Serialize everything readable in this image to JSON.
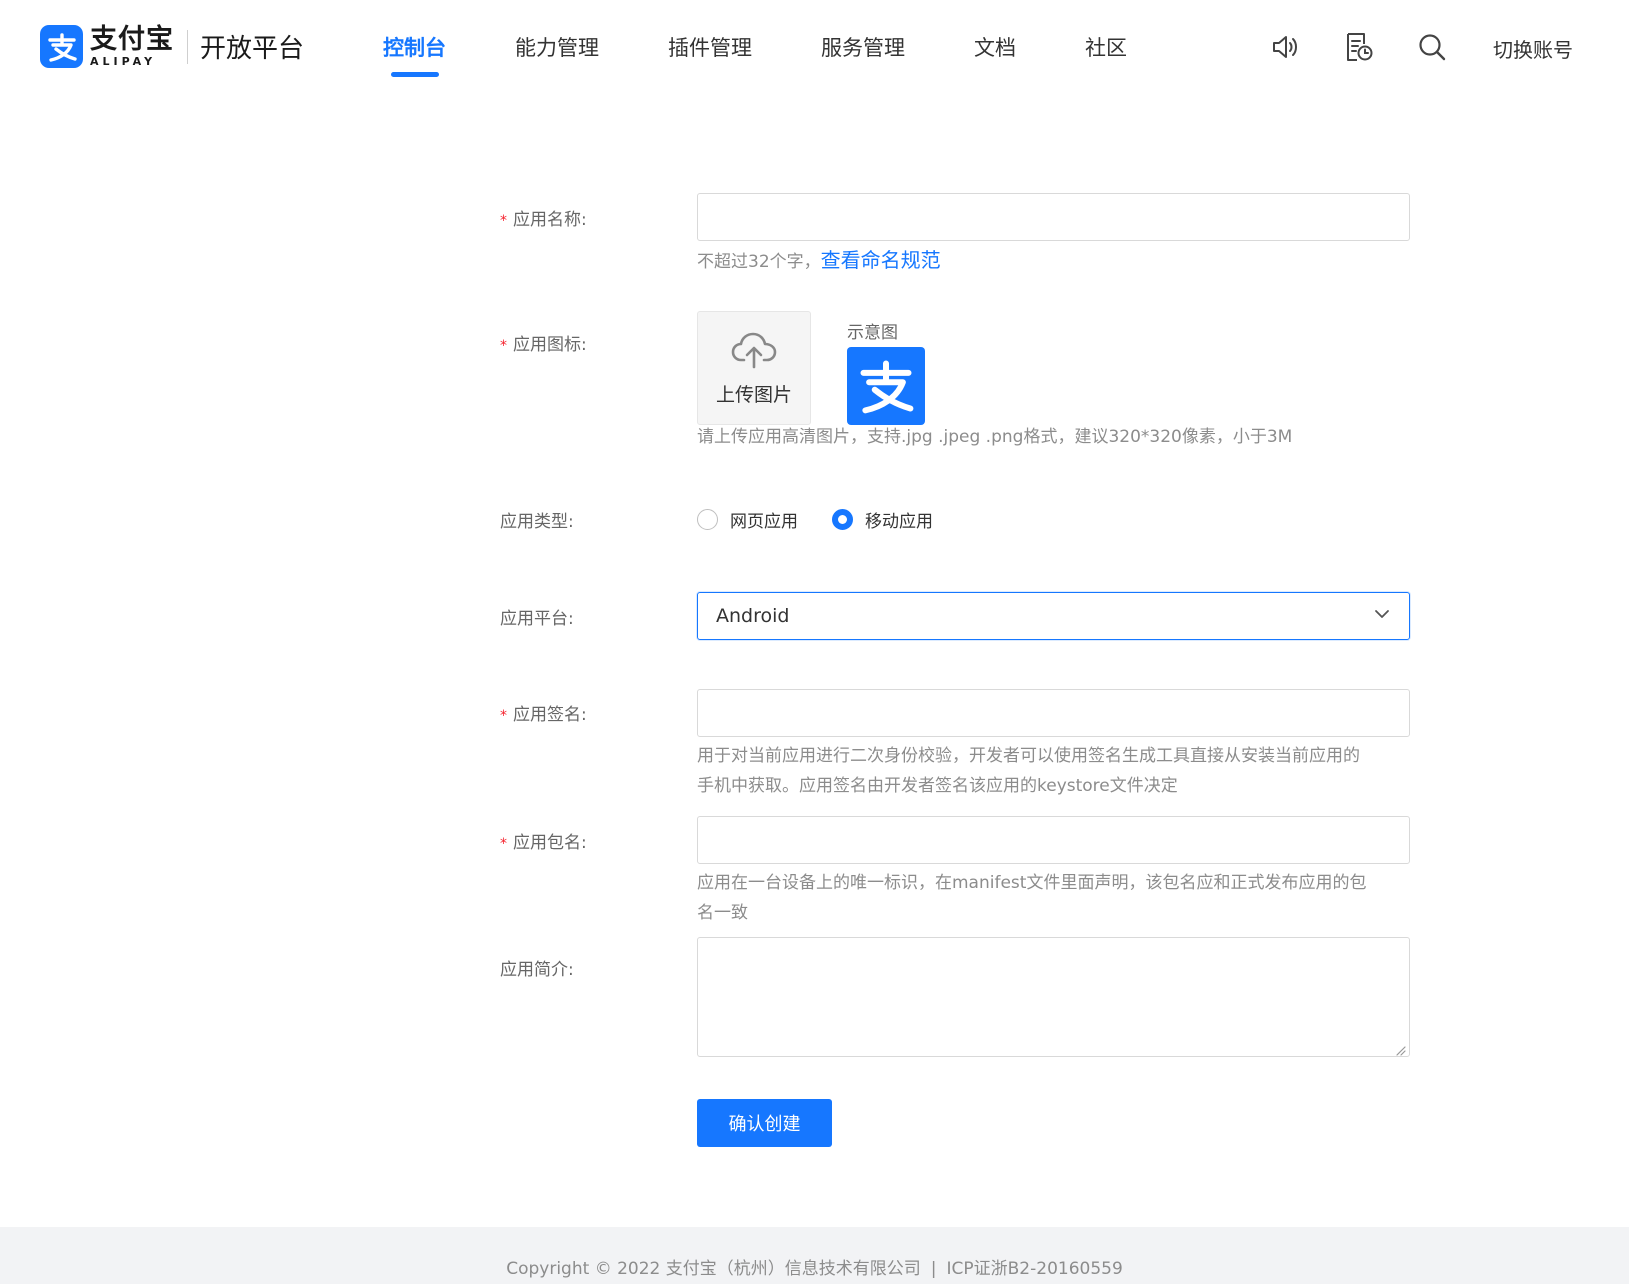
{
  "header": {
    "brand_cn": "支付宝",
    "brand_en": "ALIPAY",
    "platform": "开放平台",
    "nav": [
      {
        "label": "控制台",
        "active": true
      },
      {
        "label": "能力管理",
        "active": false
      },
      {
        "label": "插件管理",
        "active": false
      },
      {
        "label": "服务管理",
        "active": false
      },
      {
        "label": "文档",
        "active": false
      },
      {
        "label": "社区",
        "active": false
      }
    ],
    "icons": [
      "speaker-icon",
      "document-clock-icon",
      "search-icon"
    ],
    "switch_account": "切换账号"
  },
  "form": {
    "app_name": {
      "label": "应用名称:",
      "required": true,
      "value": "",
      "hint": "不超过32个字，",
      "hint_link": "查看命名规范"
    },
    "app_icon": {
      "label": "应用图标:",
      "required": true,
      "upload_label": "上传图片",
      "sample_label": "示意图",
      "hint": "请上传应用高清图片，支持.jpg .jpeg .png格式，建议320*320像素，小于3M"
    },
    "app_type": {
      "label": "应用类型:",
      "options": [
        {
          "label": "网页应用",
          "checked": false
        },
        {
          "label": "移动应用",
          "checked": true
        }
      ]
    },
    "app_platform": {
      "label": "应用平台:",
      "value": "Android"
    },
    "app_signature": {
      "label": "应用签名:",
      "required": true,
      "value": "",
      "hint_line1": "用于对当前应用进行二次身份校验，开发者可以使用签名生成工具直接从安装当前应用的",
      "hint_line2": "手机中获取。应用签名由开发者签名该应用的keystore文件决定"
    },
    "app_package": {
      "label": "应用包名:",
      "required": true,
      "value": "",
      "hint_line1": "应用在一台设备上的唯一标识，在manifest文件里面声明，该包名应和正式发布应用的包",
      "hint_line2": "名一致"
    },
    "app_intro": {
      "label": "应用简介:",
      "value": ""
    },
    "submit_label": "确认创建"
  },
  "footer": {
    "copyright": "Copyright © 2022 支付宝（杭州）信息技术有限公司",
    "separator": "|",
    "icp": "ICP证浙B2-20160559"
  },
  "colors": {
    "brand": "#1677ff",
    "required": "#f5222d",
    "hint": "#8c8c8c"
  }
}
